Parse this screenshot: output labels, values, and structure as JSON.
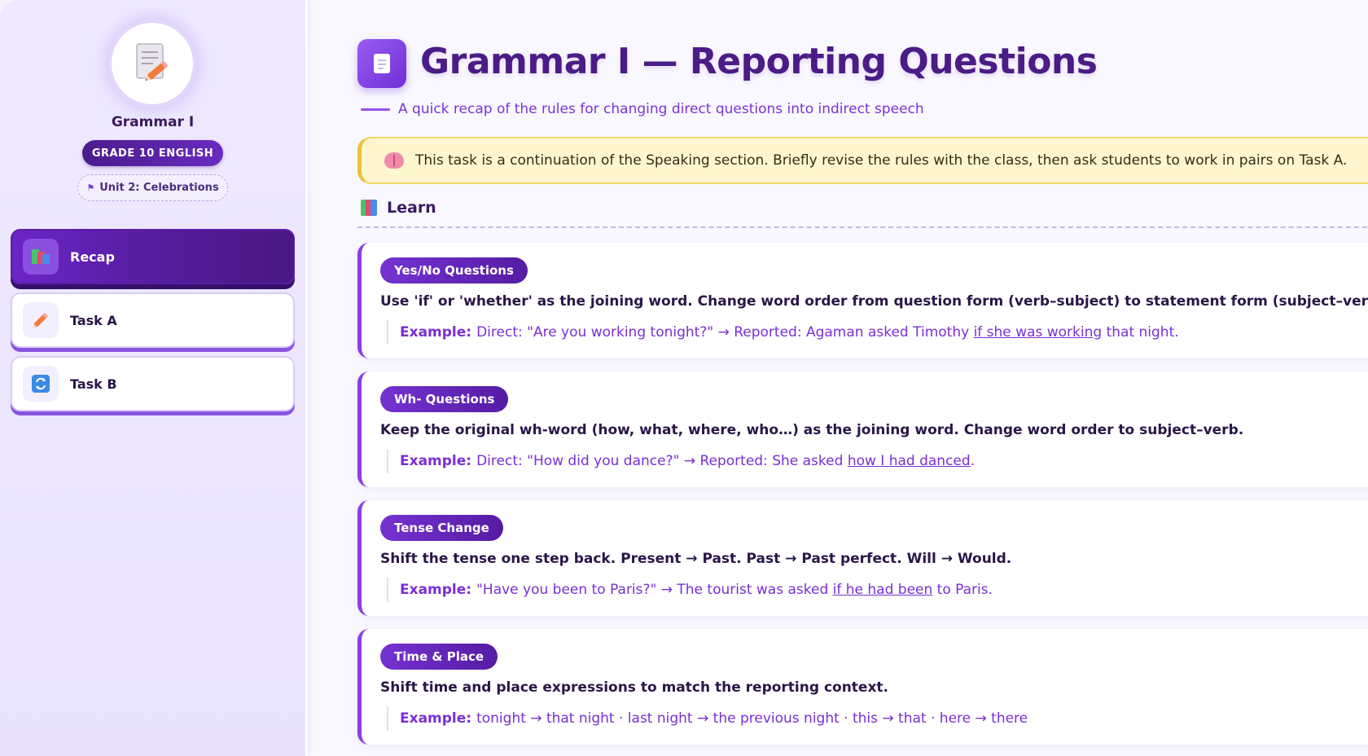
{
  "sidebar": {
    "avatar_icon": "memo-pencil-icon",
    "title": "Grammar I",
    "grade_badge": "GRADE 10 ENGLISH",
    "unit_icon": "party-flag-icon",
    "unit": "Unit 2: Celebrations",
    "items": [
      {
        "label": "Recap",
        "icon": "books-icon",
        "active": true
      },
      {
        "label": "Task A",
        "icon": "pencil-icon",
        "active": false
      },
      {
        "label": "Task B",
        "icon": "repeat-arrows-icon",
        "active": false
      }
    ]
  },
  "header": {
    "icon": "page-icon",
    "title": "Grammar I — Reporting Questions",
    "subtitle": "A quick recap of the rules for changing direct questions into indirect speech"
  },
  "notice": {
    "icon": "brain-icon",
    "text": "This task is a continuation of the Speaking section. Briefly revise the rules with the class, then ask students to work in pairs on Task A."
  },
  "learn": {
    "icon": "books-icon",
    "heading": "Learn"
  },
  "cards": [
    {
      "tag": "Yes/No Questions",
      "rule": "Use 'if' or 'whether' as the joining word. Change word order from question form (verb–subject) to statement form (subject–verb).",
      "example_label": "Example:",
      "example_before": "Direct: \"Are you working tonight?\" → Reported: Agaman asked Timothy ",
      "example_underline": "if she was working",
      "example_after": " that night."
    },
    {
      "tag": "Wh- Questions",
      "rule": "Keep the original wh-word (how, what, where, who…) as the joining word. Change word order to subject–verb.",
      "example_label": "Example:",
      "example_before": "Direct: \"How did you dance?\" → Reported: She asked ",
      "example_underline": "how I had danced",
      "example_after": "."
    },
    {
      "tag": "Tense Change",
      "rule": "Shift the tense one step back. Present → Past. Past → Past perfect. Will → Would.",
      "example_label": "Example:",
      "example_before": "\"Have you been to Paris?\" → The tourist was asked ",
      "example_underline": "if he had been",
      "example_after": " to Paris."
    },
    {
      "tag": "Time & Place",
      "rule": "Shift time and place expressions to match the reporting context.",
      "example_label": "Example:",
      "example_before": "tonight → that night · last night → the previous night · this → that · here → there",
      "example_underline": "",
      "example_after": ""
    }
  ],
  "colors": {
    "accent": "#6b25c6",
    "title": "#4a1c85",
    "notice_bg": "#fdf6cf",
    "notice_border": "#e9c23a"
  }
}
